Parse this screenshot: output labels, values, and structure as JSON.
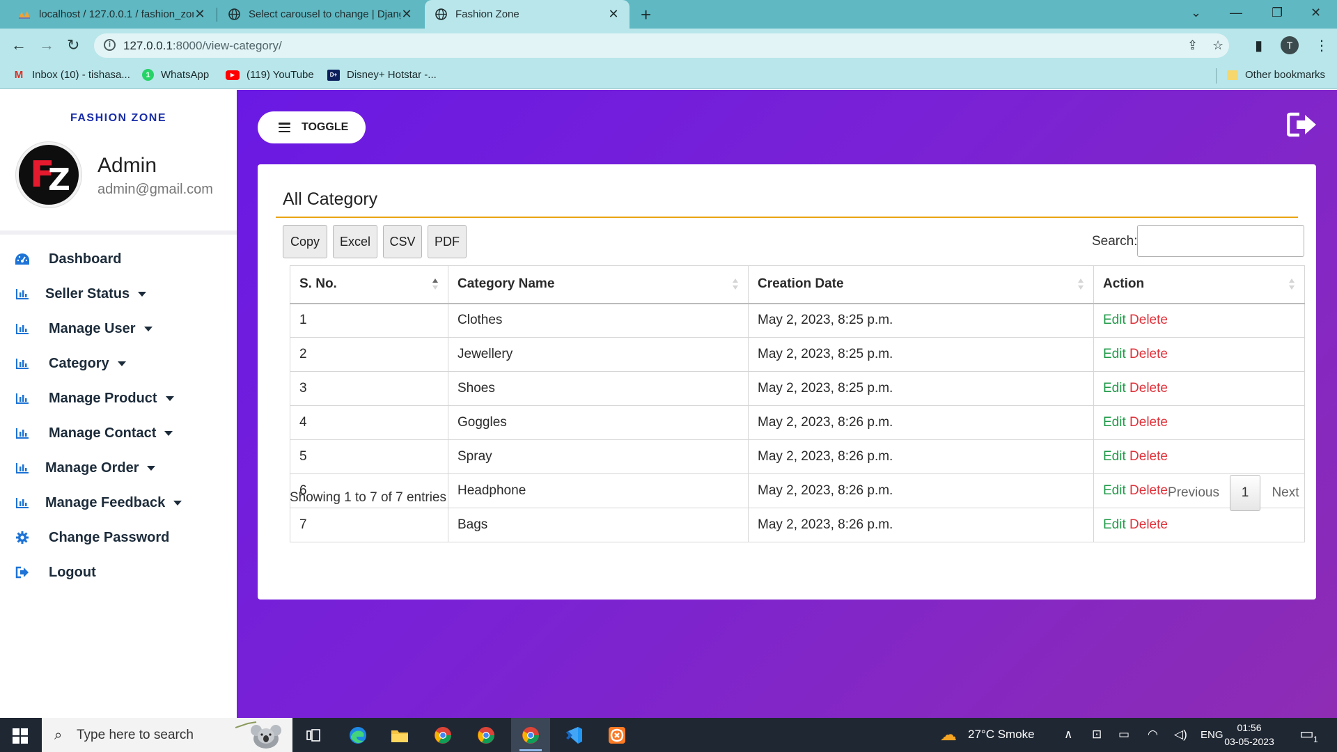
{
  "browser": {
    "tabs": [
      {
        "title": "localhost / 127.0.0.1 / fashion_zone",
        "icon": "phpmyadmin-icon"
      },
      {
        "title": "Select carousel to change | Django",
        "icon": "globe-icon"
      },
      {
        "title": "Fashion Zone",
        "icon": "globe-icon",
        "active": true
      }
    ],
    "url_host": "127.0.0.1",
    "url_path": ":8000/view-category/",
    "profile_initial": "T",
    "bookmarks": [
      {
        "label": "Inbox (10) - tishasa...",
        "icon": "gmail-icon"
      },
      {
        "label": "WhatsApp",
        "icon": "whatsapp-icon"
      },
      {
        "label": "(119) YouTube",
        "icon": "youtube-icon"
      },
      {
        "label": "Disney+ Hotstar -...",
        "icon": "hotstar-icon"
      }
    ],
    "other_bookmarks": "Other bookmarks"
  },
  "sidebar": {
    "brand": "FASHION ZONE",
    "logo_text_1": "F",
    "logo_text_2": "Z",
    "admin_name": "Admin",
    "admin_email": "admin@gmail.com",
    "items": [
      {
        "label": "Dashboard",
        "icon": "dashboard-gauge-icon",
        "dropdown": false
      },
      {
        "label": "Seller Status",
        "icon": "bar-chart-icon",
        "dropdown": true
      },
      {
        "label": "Manage User",
        "icon": "bar-chart-icon",
        "dropdown": true
      },
      {
        "label": "Category",
        "icon": "bar-chart-icon",
        "dropdown": true
      },
      {
        "label": "Manage Product",
        "icon": "bar-chart-icon",
        "dropdown": true
      },
      {
        "label": "Manage Contact",
        "icon": "bar-chart-icon",
        "dropdown": true
      },
      {
        "label": "Manage Order",
        "icon": "bar-chart-icon",
        "dropdown": true
      },
      {
        "label": "Manage Feedback",
        "icon": "bar-chart-icon",
        "dropdown": true
      },
      {
        "label": "Change Password",
        "icon": "gear-icon",
        "dropdown": false
      },
      {
        "label": "Logout",
        "icon": "sign-out-icon",
        "dropdown": false
      }
    ]
  },
  "header": {
    "toggle_label": "TOGGLE",
    "logout_icon": "sign-out-icon"
  },
  "main": {
    "title": "All Category",
    "export_buttons": [
      "Copy",
      "Excel",
      "CSV",
      "PDF"
    ],
    "search_label": "Search:",
    "search_value": "",
    "columns": [
      "S. No.",
      "Category Name",
      "Creation Date",
      "Action"
    ],
    "rows": [
      {
        "sno": "1",
        "name": "Clothes",
        "date": "May 2, 2023, 8:25 p.m.",
        "edit": "Edit",
        "delete": "Delete"
      },
      {
        "sno": "2",
        "name": "Jewellery",
        "date": "May 2, 2023, 8:25 p.m.",
        "edit": "Edit",
        "delete": "Delete"
      },
      {
        "sno": "3",
        "name": "Shoes",
        "date": "May 2, 2023, 8:25 p.m.",
        "edit": "Edit",
        "delete": "Delete"
      },
      {
        "sno": "4",
        "name": "Goggles",
        "date": "May 2, 2023, 8:26 p.m.",
        "edit": "Edit",
        "delete": "Delete"
      },
      {
        "sno": "5",
        "name": "Spray",
        "date": "May 2, 2023, 8:26 p.m.",
        "edit": "Edit",
        "delete": "Delete"
      },
      {
        "sno": "6",
        "name": "Headphone",
        "date": "May 2, 2023, 8:26 p.m.",
        "edit": "Edit",
        "delete": "Delete"
      },
      {
        "sno": "7",
        "name": "Bags",
        "date": "May 2, 2023, 8:26 p.m.",
        "edit": "Edit",
        "delete": "Delete"
      }
    ],
    "info": "Showing 1 to 7 of 7 entries",
    "pagination": {
      "previous": "Previous",
      "current": "1",
      "next": "Next"
    }
  },
  "taskbar": {
    "search_placeholder": "Type here to search",
    "weather": "27°C  Smoke",
    "language": "ENG",
    "time": "01:56",
    "date": "03-05-2023",
    "notification_count": "1"
  },
  "colors": {
    "accent_blue": "#1d73d6",
    "brand_navy": "#1a2ea8",
    "gradient_start": "#6a19e4",
    "gradient_end": "#8e2cb4",
    "title_rule": "#e8a412",
    "edit_green": "#1f9a48",
    "delete_red": "#e0323a"
  }
}
